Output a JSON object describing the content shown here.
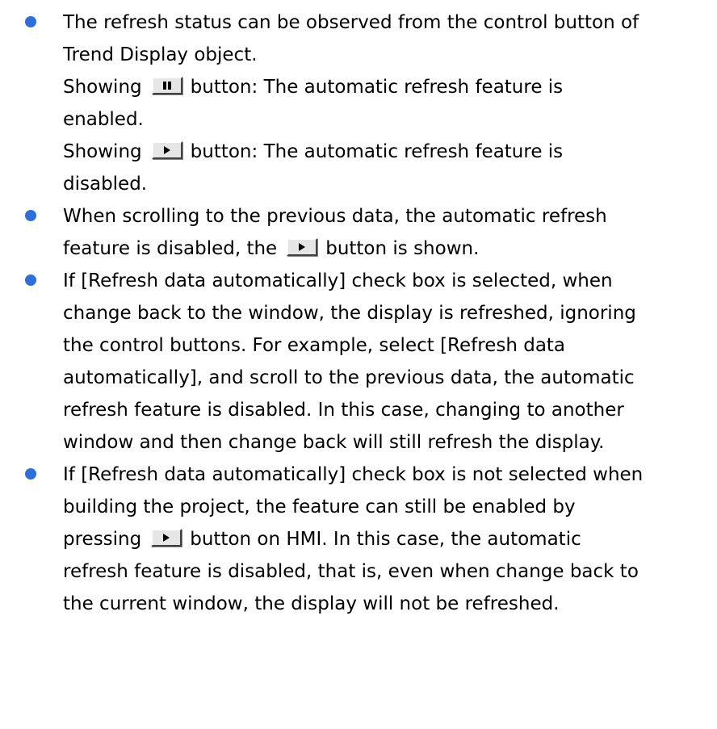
{
  "bullet_color": "#2f6fd6",
  "icons": {
    "pause": "pause-button-icon",
    "play": "play-button-icon"
  },
  "items": [
    {
      "line1": "The refresh status can be observed from the control button of",
      "line2": "Trend Display object.",
      "line3a": "Showing",
      "line3b": "button: The automatic refresh feature is",
      "line4": "enabled.",
      "line5a": "Showing",
      "line5b": "button: The automatic refresh feature is",
      "line6": "disabled."
    },
    {
      "line1": "When scrolling to the previous data, the automatic refresh",
      "line2a": "feature is disabled, the",
      "line2b": "button is shown."
    },
    {
      "line1": "If [Refresh data automatically] check box is selected, when",
      "line2": "change back to the window, the display is refreshed, ignoring",
      "line3": "the control buttons. For example, select [Refresh data",
      "line4": "automatically], and scroll to the previous data, the automatic",
      "line5": "refresh feature is disabled. In this case, changing to another",
      "line6": "window and then change back will still refresh the display."
    },
    {
      "line1": "If [Refresh data automatically] check box is not selected when",
      "line2": "building the project, the feature can still be enabled by",
      "line3a": "pressing",
      "line3b": "button on HMI. In this case, the automatic",
      "line4": "refresh feature is disabled, that is, even when change back to",
      "line5": "the current window, the display will not be refreshed."
    }
  ]
}
